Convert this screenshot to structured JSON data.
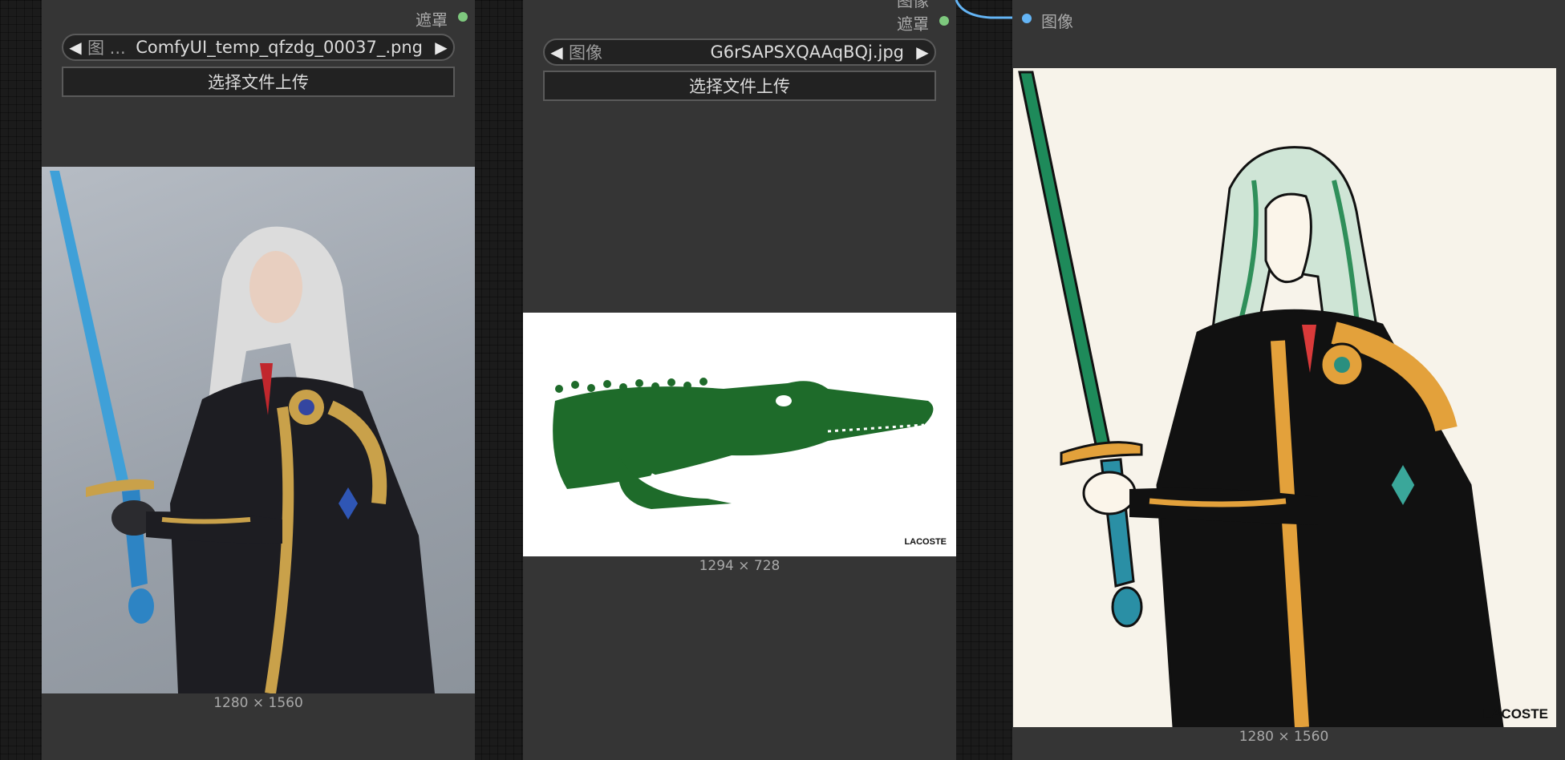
{
  "node1": {
    "mask_output_label": "遮罩",
    "image_combo": {
      "label": "图 ...",
      "value": "ComfyUI_temp_qfzdg_00037_.png"
    },
    "upload_button": "选择文件上传",
    "image_dimensions": "1280 × 1560"
  },
  "node2": {
    "top_partial_label": "图像",
    "mask_output_label": "遮罩",
    "image_combo": {
      "label": "图像",
      "value": "G6rSAPSXQAAqBQj.jpg"
    },
    "upload_button": "选择文件上传",
    "image_dimensions": "1294 × 728",
    "image_logo_text": "LACOSTE"
  },
  "node3": {
    "image_input_label": "图像",
    "image_dimensions": "1280 × 1560",
    "image_logo_text": "LACOSTE"
  },
  "colors": {
    "node_bg": "#353535",
    "canvas_bg": "#1b1b1b",
    "mask_slot": "#7ec97e",
    "image_slot": "#64b5f6",
    "link_wire": "#64b5f6"
  }
}
